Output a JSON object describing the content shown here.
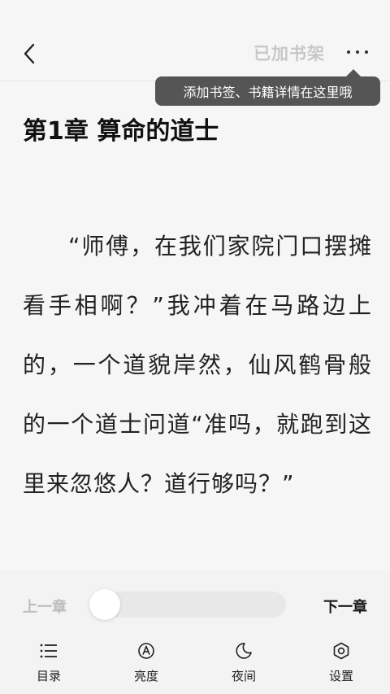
{
  "header": {
    "back_icon": "chevron-left-icon",
    "shelf_status": "已加书架",
    "more_icon": "more-dots-icon"
  },
  "tooltip": {
    "text": "添加书签、书籍详情在这里哦"
  },
  "chapter": {
    "title": "第1章 算命的道士",
    "body": "“师傅，在我们家院门口摆摊看手相啊？”我冲着在马路边上的，一个道貌岸然，仙风鹤骨般的一个道士问道“准吗，就跑到这里来忽悠人？道行够吗？”"
  },
  "navigation": {
    "prev_label": "上一章",
    "next_label": "下一章",
    "progress": 0
  },
  "menu": [
    {
      "label": "目录",
      "icon": "list-icon"
    },
    {
      "label": "亮度",
      "icon": "brightness-icon"
    },
    {
      "label": "夜间",
      "icon": "moon-icon"
    },
    {
      "label": "设置",
      "icon": "settings-icon"
    }
  ]
}
